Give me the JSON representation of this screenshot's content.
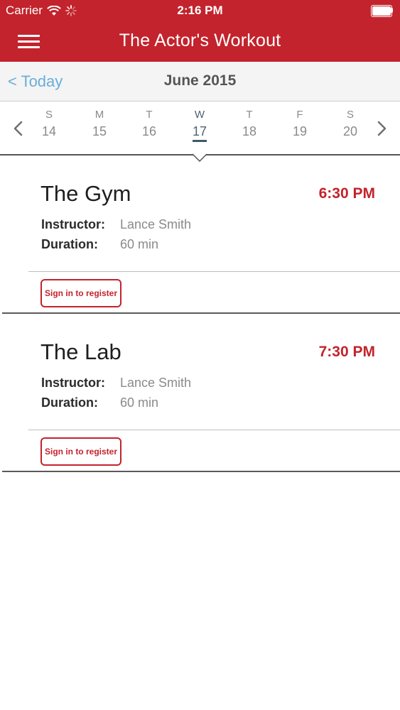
{
  "status_bar": {
    "carrier": "Carrier",
    "time": "2:16 PM"
  },
  "nav_bar": {
    "title": "The Actor's Workout"
  },
  "month_bar": {
    "back_label": "< Today",
    "month": "June 2015"
  },
  "week": {
    "days": [
      {
        "weekday": "S",
        "date": "14"
      },
      {
        "weekday": "M",
        "date": "15"
      },
      {
        "weekday": "T",
        "date": "16"
      },
      {
        "weekday": "W",
        "date": "17"
      },
      {
        "weekday": "T",
        "date": "18"
      },
      {
        "weekday": "F",
        "date": "19"
      },
      {
        "weekday": "S",
        "date": "20"
      }
    ],
    "selected_index": 3
  },
  "classes": [
    {
      "title": "The Gym",
      "time": "6:30 PM",
      "instructor_label": "Instructor:",
      "instructor": "Lance Smith",
      "duration_label": "Duration:",
      "duration": "60 min",
      "register_label": "Sign in to register"
    },
    {
      "title": "The Lab",
      "time": "7:30 PM",
      "instructor_label": "Instructor:",
      "instructor": "Lance Smith",
      "duration_label": "Duration:",
      "duration": "60 min",
      "register_label": "Sign in to register"
    }
  ],
  "colors": {
    "brand": "#c3232c",
    "link": "#6aaed9",
    "selected_day": "#3e5a66"
  }
}
